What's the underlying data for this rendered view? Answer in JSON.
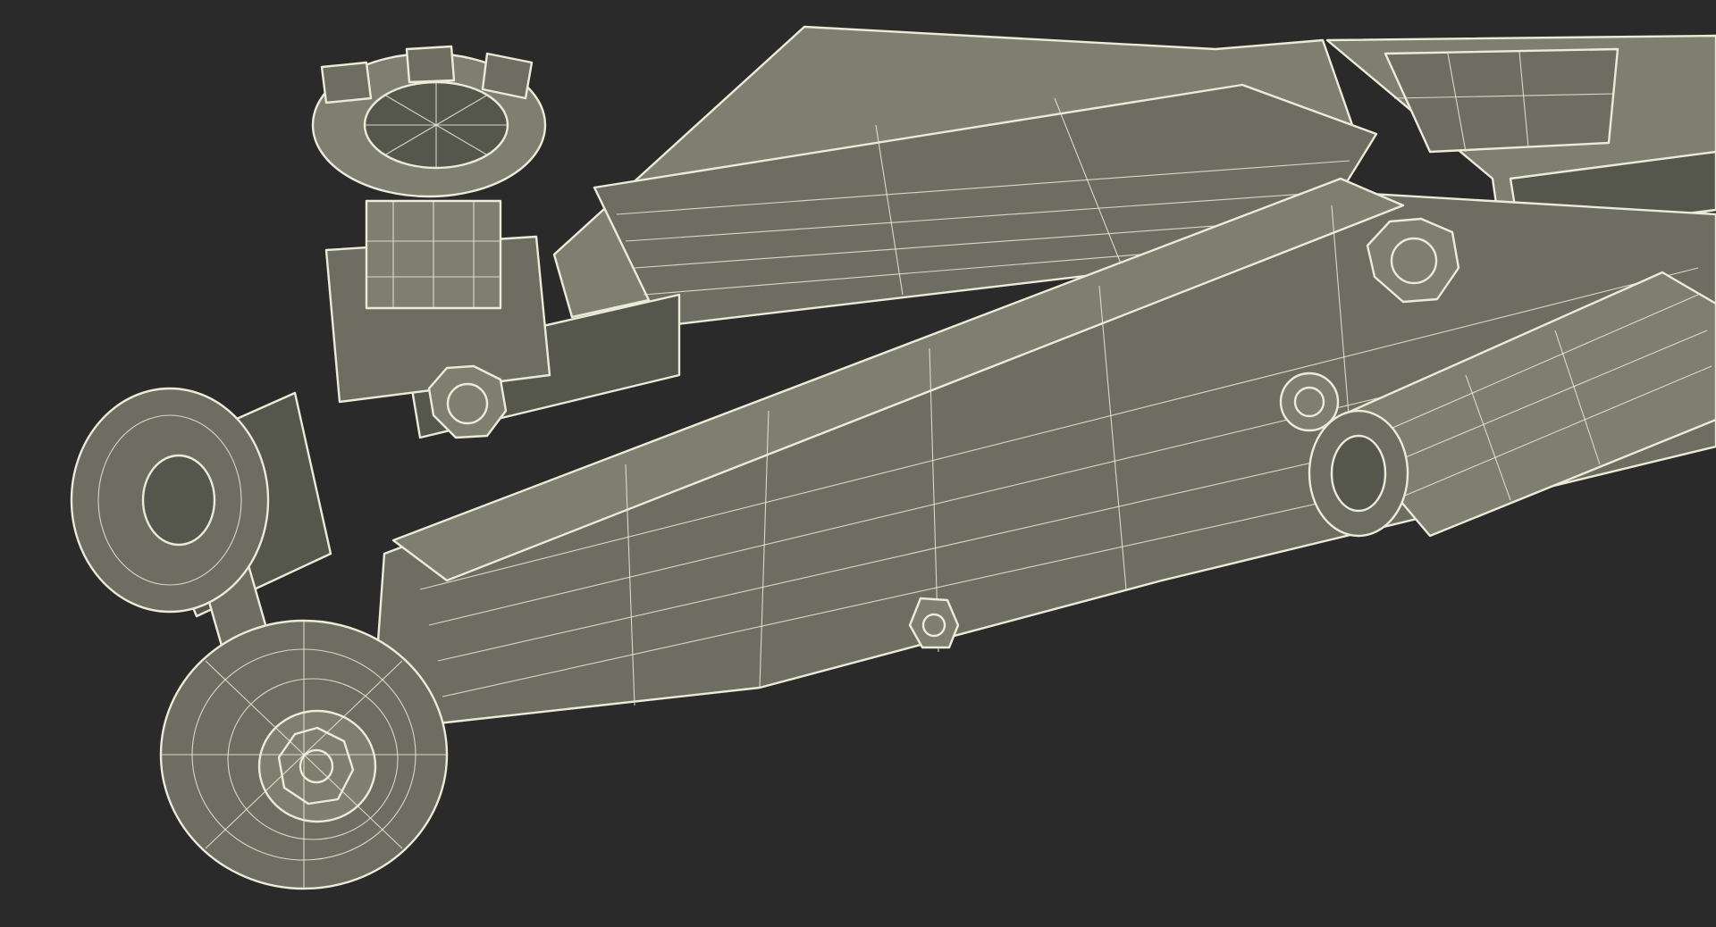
{
  "scene": {
    "subject": "floor-jack-wireframe-render",
    "colors": {
      "background": "#2a2a2a",
      "body": "#6d6e61",
      "body_dark": "#55574c",
      "body_light": "#7e7f71",
      "wire": "#ecebd8"
    }
  }
}
